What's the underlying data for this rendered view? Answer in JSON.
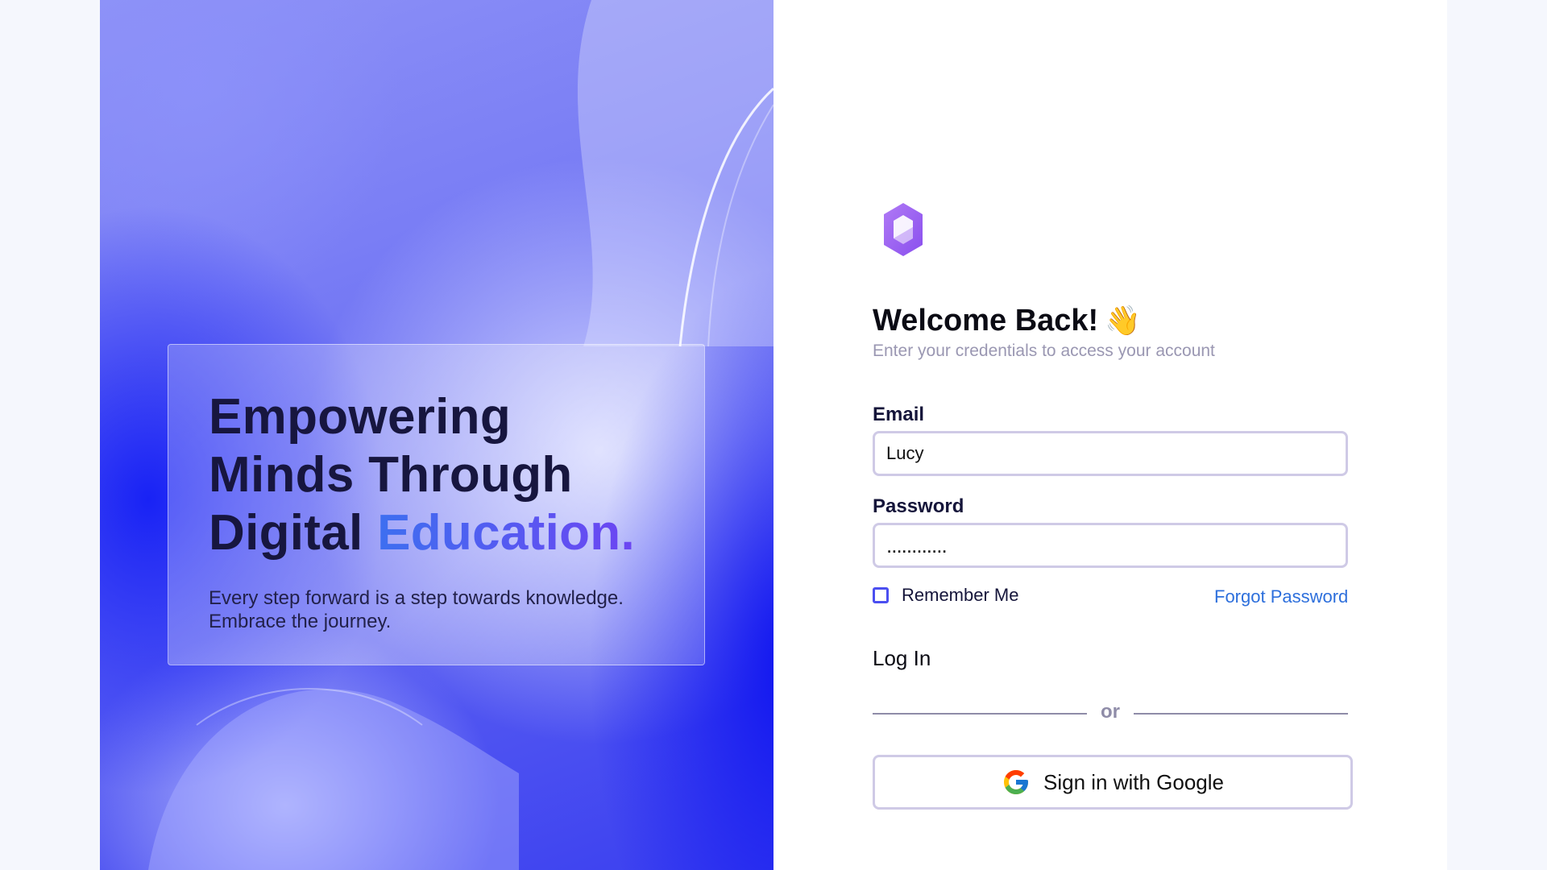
{
  "hero": {
    "title_line1": "Empowering",
    "title_line2": "Minds Through",
    "title_line3_plain": "Digital ",
    "title_line3_accent": "Education.",
    "subtitle": "Every step forward is a step towards knowledge. Embrace the journey."
  },
  "login": {
    "heading": "Welcome Back!",
    "wave_emoji": "👋",
    "subtitle": "Enter your credentials to access your account",
    "email_label": "Email",
    "email_value": "Lucy",
    "password_label": "Password",
    "password_value": "............",
    "remember_label": "Remember Me",
    "remember_checked": false,
    "forgot_label": "Forgot Password",
    "login_label": "Log In",
    "divider_text": "or",
    "google_label": "Sign in with Google"
  },
  "colors": {
    "accent": "#4b4ff0",
    "link": "#2d6fdc",
    "logo": "#9b5cf0"
  }
}
